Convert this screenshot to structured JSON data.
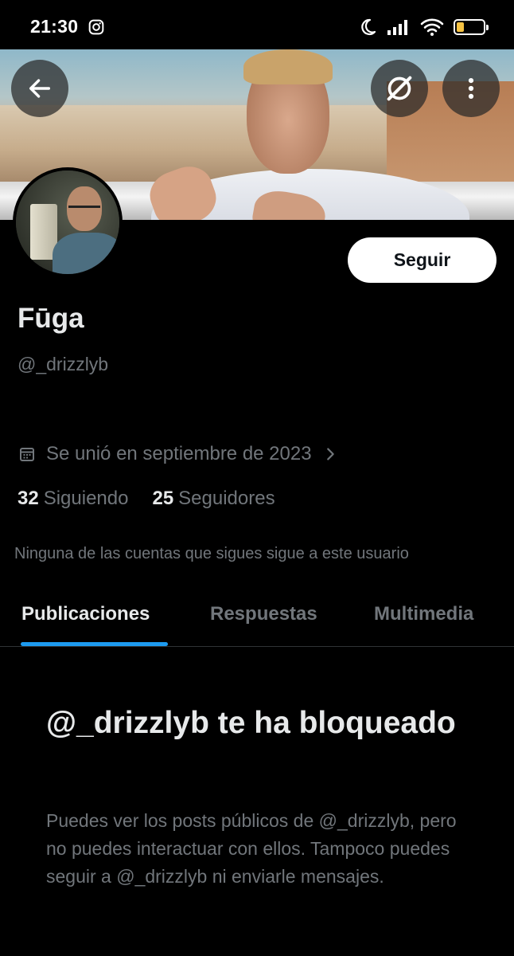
{
  "status_bar": {
    "time": "21:30",
    "battery_level": "36",
    "battery_color": "#f6c343",
    "icons": [
      "instagram-icon",
      "moon-icon",
      "signal-icon",
      "wifi-icon",
      "battery-icon"
    ]
  },
  "header": {
    "back_icon": "arrow-left-icon",
    "grok_icon": "grok-icon",
    "more_icon": "more-vertical-icon"
  },
  "profile": {
    "display_name": "Fūga",
    "handle": "@_drizzlyb",
    "follow_label": "Seguir",
    "joined": "Se unió en septiembre de 2023",
    "following_count": "32",
    "following_label": "Siguiendo",
    "followers_count": "25",
    "followers_label": "Seguidores",
    "followers_note": "Ninguna de las cuentas que sigues sigue a este usuario"
  },
  "tabs": [
    {
      "label": "Publicaciones",
      "active": true
    },
    {
      "label": "Respuestas",
      "active": false
    },
    {
      "label": "Multimedia",
      "active": false
    }
  ],
  "blocked": {
    "title": "@_drizzlyb te ha bloqueado",
    "description": "Puedes ver los posts públicos de @_drizzlyb, pero no puedes interactuar con ellos. Tampoco puedes seguir a @_drizzlyb ni enviarle mensajes."
  },
  "colors": {
    "background": "#000000",
    "text_primary": "#e7e9ea",
    "text_secondary": "#71767b",
    "accent": "#1d9bf0"
  }
}
